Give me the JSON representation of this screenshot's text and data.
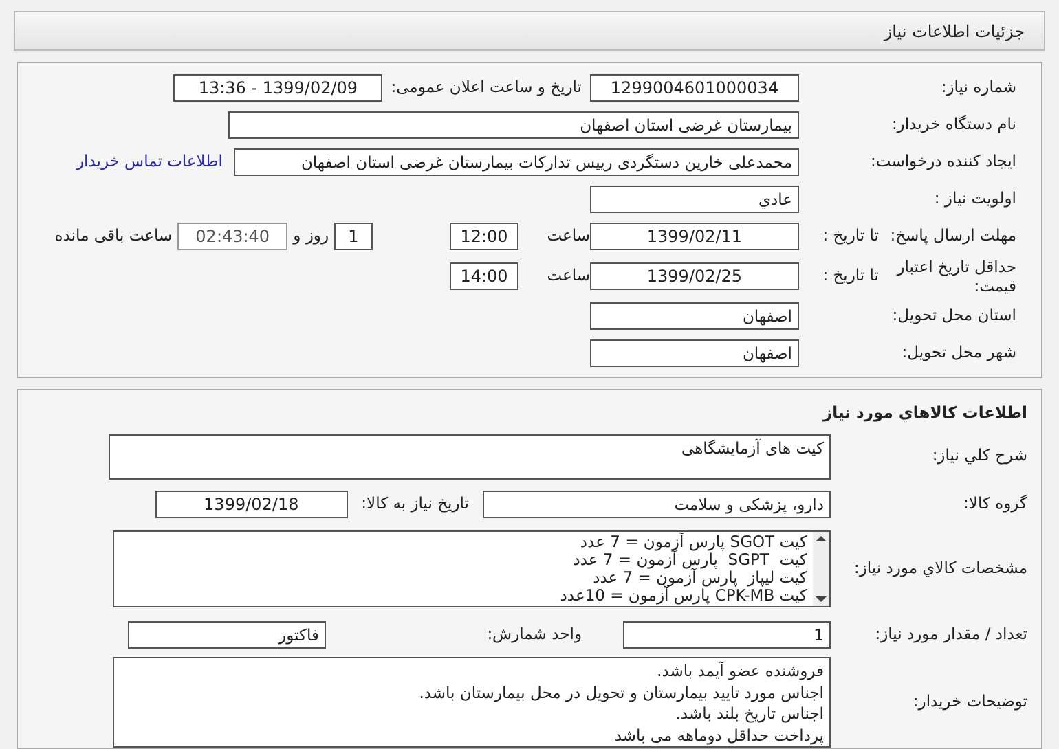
{
  "header": {
    "title": "جزئیات اطلاعات نیاز"
  },
  "need": {
    "number": {
      "label": "شماره نیاز:",
      "value": "1299004601000034"
    },
    "announce": {
      "label": "تاریخ و ساعت اعلان عمومی:",
      "value": "1399/02/09 - 13:36"
    },
    "buyer": {
      "label": "نام دستگاه خریدار:",
      "value": "بیمارستان غرضی استان اصفهان"
    },
    "requester": {
      "label": "ایجاد کننده درخواست:",
      "value": "محمدعلی خارین دستگردی رییس تدارکات بیمارستان غرضی استان اصفهان",
      "link": "اطلاعات تماس خریدار"
    },
    "priority": {
      "label": "اولویت نیاز :",
      "value": "عادي"
    },
    "deadline": {
      "label": "مهلت ارسال پاسخ:",
      "to_label": "تا تاریخ :",
      "date": "1399/02/11",
      "time_label": "ساعت",
      "time": "12:00",
      "days": "1",
      "days_label": "روز و",
      "remaining": "02:43:40",
      "remaining_label": "ساعت باقی مانده"
    },
    "validity": {
      "label": "حداقل تاریخ اعتبار قیمت:",
      "to_label": "تا تاریخ :",
      "date": "1399/02/25",
      "time_label": "ساعت",
      "time": "14:00"
    },
    "province": {
      "label": "استان محل تحویل:",
      "value": "اصفهان"
    },
    "city": {
      "label": "شهر محل تحویل:",
      "value": "اصفهان"
    }
  },
  "goods": {
    "title": "اطلاعات کالاهاي مورد نیاز",
    "description": {
      "label": "شرح کلي نیاز:",
      "value": "کیت های آزمایشگاهی"
    },
    "group": {
      "label": "گروه کالا:",
      "value": "دارو، پزشکی و سلامت"
    },
    "need_date": {
      "label": "تاریخ نیاز به کالا:",
      "value": "1399/02/18"
    },
    "specs": {
      "label": "مشخصات کالاي مورد نیاز:",
      "lines": [
        "کیت SGOT پارس آزمون = 7 عدد",
        "کیت  SGPT  پارس آزمون = 7 عدد",
        "کیت لیپاز  پارس آزمون = 7 عدد",
        "کیت CPK-MB پارس آزمون = 10عدد"
      ]
    },
    "quantity": {
      "label": "تعداد / مقدار مورد نیاز:",
      "value": "1"
    },
    "unit": {
      "label": "واحد شمارش:",
      "value": "فاکتور"
    },
    "notes": {
      "label": "توضیحات خریدار:",
      "lines": [
        "فروشنده عضو آیمد باشد.",
        "اجناس مورد تایید بیمارستان و تحویل در محل بیمارستان باشد.",
        "اجناس تاریخ بلند باشد.",
        "پرداخت حداقل دوماهه می باشد"
      ]
    }
  }
}
